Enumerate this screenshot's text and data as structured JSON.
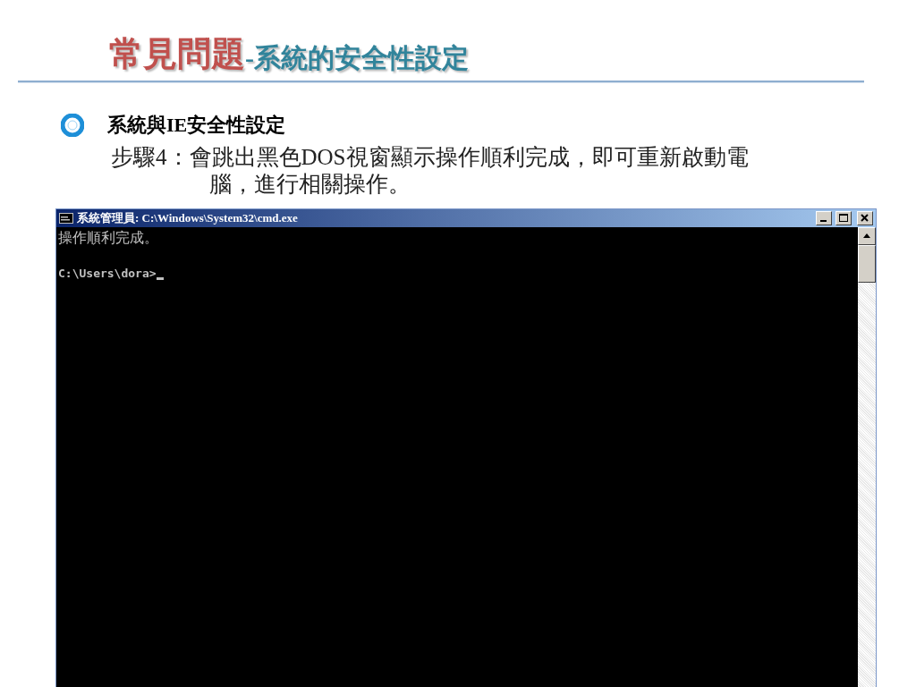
{
  "slide": {
    "title": {
      "main": "常見問題",
      "sub": "-系統的安全性設定"
    },
    "bullet": "系統與IE安全性設定",
    "step": {
      "label": "步驟4：",
      "lines": [
        "會跳出黑色DOS視窗顯示操作順利完成，即可重新啟動電",
        "腦，進行相關操作。"
      ]
    }
  },
  "console_window": {
    "title": "系統管理員: C:\\Windows\\System32\\cmd.exe",
    "output": "操作順利完成。",
    "prompt": "C:\\Users\\dora>"
  }
}
